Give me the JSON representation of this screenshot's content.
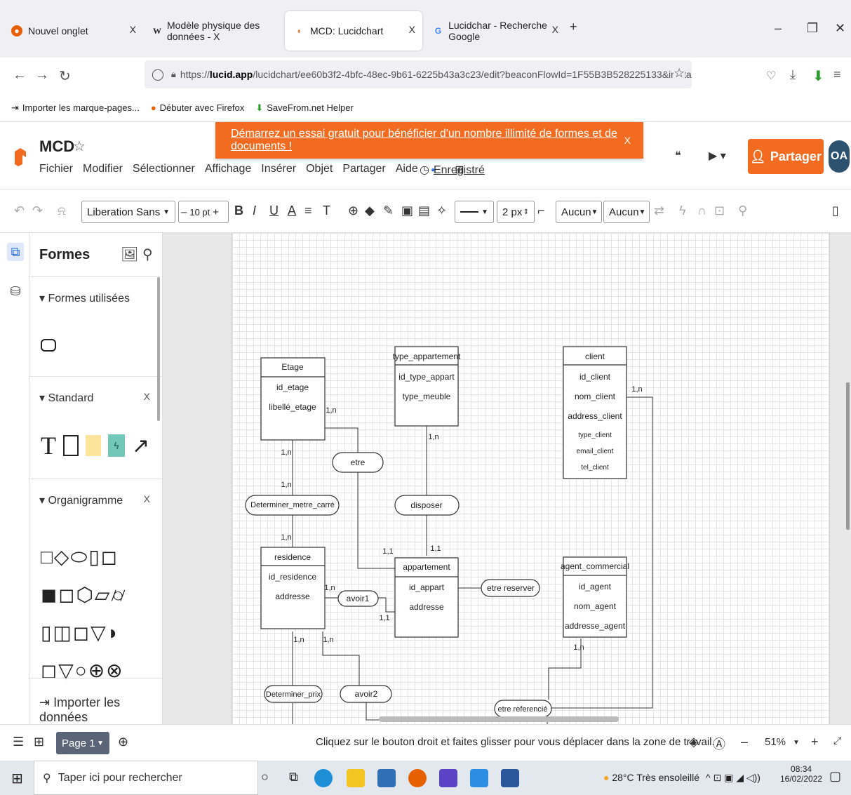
{
  "browser": {
    "tabs": [
      {
        "title": "Nouvel onglet",
        "close": "X"
      },
      {
        "title": "Modèle physique des données - X",
        "icon": "W"
      },
      {
        "title": "MCD: Lucidchart",
        "close": "X"
      },
      {
        "title": "Lucidchar - Recherche Google",
        "close": "X"
      }
    ],
    "new_tab": "+",
    "url_prefix": "https://",
    "url_host": "lucid.app",
    "url_rest": "/lucidchart/ee60b3f2-4bfc-48ec-9b61-6225b43a3c23/edit?beaconFlowId=1F55B3B528225133&invitationId=ir",
    "bookmarks": [
      "Importer les marque-pages...",
      "Débuter avec Firefox",
      "SaveFrom.net Helper"
    ]
  },
  "lucid": {
    "doc_title": "MCD",
    "menu": [
      "Fichier",
      "Modifier",
      "Sélectionner",
      "Affichage",
      "Insérer",
      "Objet",
      "Partager",
      "Aide"
    ],
    "saved": "Enregistré",
    "banner_text": "Démarrez un essai gratuit pour bénéficier d'un nombre illimité de formes et de documents !",
    "banner_close": "X",
    "share_label": "Partager",
    "avatar": "OA",
    "accent": "#f26b21"
  },
  "toolbar": {
    "font": "Liberation Sans",
    "font_size": "10 pt",
    "line_width": "2 px",
    "arrow_start": "Aucun",
    "arrow_end": "Aucun"
  },
  "panel": {
    "title": "Formes",
    "sections": [
      {
        "name": "Formes utilisées"
      },
      {
        "name": "Standard",
        "close": "X"
      },
      {
        "name": "Organigramme",
        "close": "X"
      }
    ],
    "import": "Importer les données"
  },
  "diagram": {
    "entities": [
      {
        "name": "Etage",
        "attrs": [
          "id_etage",
          "libellé_etage"
        ]
      },
      {
        "name": "type_appartement",
        "attrs": [
          "id_type_appart",
          "type_meuble"
        ]
      },
      {
        "name": "client",
        "attrs": [
          "id_client",
          "nom_client",
          "address_client",
          "type_client",
          "email_client",
          "tel_client"
        ]
      },
      {
        "name": "residence",
        "attrs": [
          "id_residence",
          "addresse"
        ]
      },
      {
        "name": "appartement",
        "attrs": [
          "id_appart",
          "addresse"
        ]
      },
      {
        "name": "agent_commercial",
        "attrs": [
          "id_agent",
          "nom_agent",
          "addresse_agent"
        ]
      }
    ],
    "relations": [
      "etre",
      "Determiner_metre_carré",
      "disposer",
      "avoir1",
      "etre reserver",
      "Determiner_prix",
      "avoir2",
      "etre referencié"
    ],
    "cardinalities": [
      "1,n",
      "1,n",
      "1,n",
      "1,n",
      "1,n",
      "1,1",
      "1,1",
      "1,n",
      "1,1",
      "1,n",
      "1,n",
      "1,n"
    ]
  },
  "status": {
    "page": "Page 1",
    "hint": "Cliquez sur le bouton droit et faites glisser pour vous déplacer dans la zone de travail.",
    "zoom": "51%"
  },
  "taskbar": {
    "search_placeholder": "Taper ici pour rechercher",
    "weather": "28°C  Très ensoleillé",
    "time": "08:34",
    "date": "16/02/2022"
  }
}
